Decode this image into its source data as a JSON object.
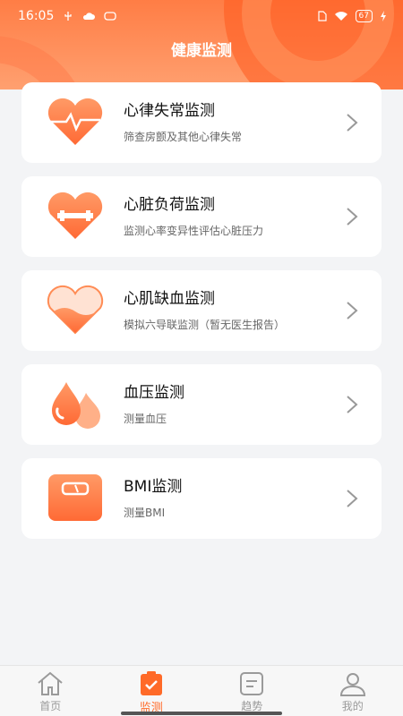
{
  "status_bar": {
    "time": "16:05",
    "battery": "67"
  },
  "header": {
    "title": "健康监测"
  },
  "cards": [
    {
      "name": "心律失常监测",
      "desc": "筛查房颤及其他心律失常",
      "icon": "heart-pulse-icon"
    },
    {
      "name": "心脏负荷监测",
      "desc": "监测心率变异性评估心脏压力",
      "icon": "heart-dumbbell-icon"
    },
    {
      "name": "心肌缺血监测",
      "desc": "模拟六导联监测（暂无医生报告）",
      "icon": "heart-half-filled-icon"
    },
    {
      "name": "血压监测",
      "desc": "测量血压",
      "icon": "blood-drops-icon"
    },
    {
      "name": "BMI监测",
      "desc": "测量BMI",
      "icon": "scale-icon"
    }
  ],
  "tabbar": {
    "items": [
      {
        "label": "首页",
        "icon": "home-icon",
        "active": false
      },
      {
        "label": "监测",
        "icon": "clipboard-check-icon",
        "active": true
      },
      {
        "label": "趋势",
        "icon": "trend-list-icon",
        "active": false
      },
      {
        "label": "我的",
        "icon": "user-icon",
        "active": false
      }
    ]
  },
  "colors": {
    "accent": "#ff6a28",
    "header": "#ff7d45"
  }
}
